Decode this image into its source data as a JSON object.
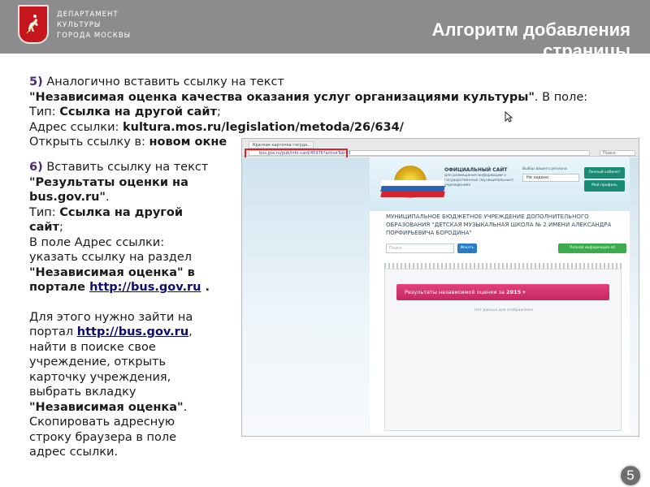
{
  "header": {
    "department": [
      "ДЕПАРТАМЕНТ",
      "КУЛЬТУРЫ",
      "ГОРОДА МОСКВЫ"
    ],
    "title_line1": "Алгоритм добавления",
    "title_line2": "страницы",
    "banner_color": "#8c8c8c",
    "emblem_color": "#c4161c"
  },
  "step5": {
    "num": "5)",
    "intro": "Аналогично вставить ссылку на текст",
    "quote": "\"Независимая оценка качества оказания услуг организациями культуры\"",
    "quote_tail": ". В поле:",
    "type_label": "Тип: ",
    "type_value": "Ссылка на другой сайт",
    "type_tail": ";",
    "addr_label": "Адрес ссылки: ",
    "addr_value": "kultura.mos.ru/legislation/metoda/26/634/",
    "open_label": "Открыть ссылку в: ",
    "open_value": "новом окне"
  },
  "step6": {
    "num": "6)",
    "intro": "Вставить ссылку на текст ",
    "quote": "\"Результаты оценки на bus.gov.ru\"",
    "dot": ".",
    "type_label": "Тип: ",
    "type_value": "Ссылка на другой сайт",
    "type_tail": ";",
    "addr_intro": "В поле Адрес ссылки: указать ссылку на раздел ",
    "section": "\"Независимая оценка\"",
    "in_portal": " в портале ",
    "portal_link": "http://bus.gov.ru",
    "portal_tail": " .",
    "para2_a": "Для этого нужно зайти на портал ",
    "para2_link": "http://bus.gov.ru",
    "para2_b": ", найти в поиске свое учреждение, открыть карточку учреждения, выбрать вкладку ",
    "tab_name": "\"Независимая оценка\"",
    "para2_c": ". Скопировать адресную строку браузера в поле адрес ссылки."
  },
  "screenshot": {
    "tab_title": "Краткая карточка госуда...",
    "url": "bus.gov.ru/pub/info-card/45976?activeTab=3",
    "browser_search": "Поиск",
    "site_title": "ОФИЦИАЛЬНЫЙ САЙТ",
    "site_subtitle": "для размещения информации о государственных (муниципальных) учреждениях",
    "region_label": "Выбор вашего региона",
    "region_value": "Не задано",
    "btn_cabinet": "Личный кабинет",
    "btn_profile": "Мой профиль",
    "org_name": "МУНИЦИПАЛЬНОЕ БЮДЖЕТНОЕ УЧРЕЖДЕНИЕ ДОПОЛНИТЕЛЬНОГО ОБРАЗОВАНИЯ \"ДЕТСКАЯ МУЗЫКАЛЬНАЯ ШКОЛА № 2 ИМЕНИ АЛЕКСАНДРА ПОРФИРЬЕВИЧА БОРОДИНА\"",
    "search_placeholder": "Поиск",
    "btn_find": "Искать",
    "btn_full_info": "Полная информация об учреждении",
    "results_label": "Результаты независимой оценки за",
    "results_year": "2015",
    "no_data": "Нет данных для отображения"
  },
  "slide_number": "5"
}
